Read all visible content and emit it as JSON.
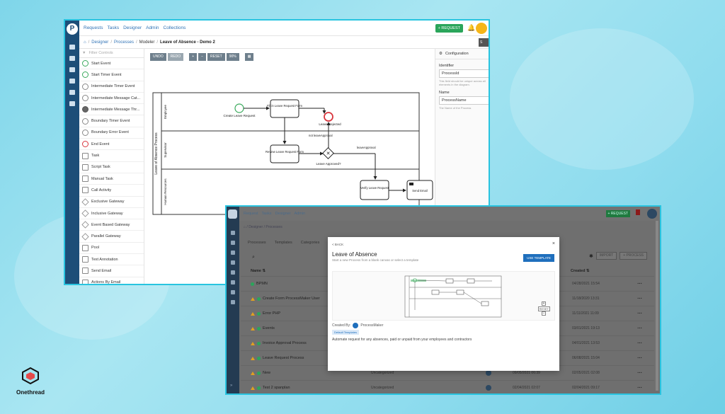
{
  "modeler": {
    "nav": [
      "Requests",
      "Tasks",
      "Designer",
      "Admin",
      "Collections"
    ],
    "request_button": "+ REQUEST",
    "breadcrumb": [
      "Designer",
      "Processes",
      "Modeler"
    ],
    "breadcrumb_current": "Leave of Absence - Demo 2",
    "save_label": "S",
    "filter_placeholder": "Filter Controls",
    "palette": [
      "Start Event",
      "Start Timer Event",
      "Intermediate Timer Event",
      "Intermediate Message Cat...",
      "Intermediate Message Thr...",
      "Boundary Timer Event",
      "Boundary Error Event",
      "End Event",
      "Task",
      "Script Task",
      "Manual Task",
      "Call Activity",
      "Exclusive Gateway",
      "Inclusive Gateway",
      "Event Based Gateway",
      "Parallel Gateway",
      "Pool",
      "Text Annotation",
      "Send Email",
      "Actions By Email"
    ],
    "toolbar": {
      "undo": "UNDO",
      "redo": "REDO",
      "plus": "+",
      "minus": "−",
      "reset": "RESET",
      "zoom": "90%"
    },
    "diagram": {
      "pool_label": "Leave of Absence Process",
      "lanes": [
        "Employee",
        "Supervisor",
        "Human Resources"
      ],
      "create_leave": "Create Leave Request",
      "fill_form": "Fill in Leave Request Form",
      "leave_rejected": "Leave Rejected",
      "not_approval": "not leaveApproval",
      "review_form": "Review Leave Request Form",
      "approved_q": "Leave Approved?",
      "leave_approval": "leaveApproval",
      "verify": "Verify Leave Request",
      "send_email": "Send Email",
      "leave_approved": "Leave Approved"
    },
    "config": {
      "header": "Configuration",
      "identifier_label": "Identifier",
      "identifier_value": "ProcessId",
      "identifier_help": "This field should be unique across all elements in the diagram.",
      "name_label": "Name",
      "name_value": "ProcessName",
      "name_help": "The Name of the Process"
    }
  },
  "processes": {
    "nav": [
      "Request",
      "Tasks",
      "Designer",
      "Admin"
    ],
    "request_button": "+ REQUEST",
    "breadcrumb": "Designer / Processes",
    "tabs": [
      "Processes",
      "Templates",
      "Categories"
    ],
    "import_btn": "IMPORT",
    "new_btn": "+ PROCESS",
    "col_name": "Name",
    "col_created": "Created",
    "rows": [
      {
        "name": "BPMN",
        "warn": false,
        "cat": "",
        "mod": "",
        "created": "04/28/2021 15:54"
      },
      {
        "name": "Create Form ProcessMaker User",
        "warn": true,
        "cat": "",
        "mod": "",
        "created": "11/18/2020 13:31"
      },
      {
        "name": "Error PHP",
        "warn": true,
        "cat": "",
        "mod": "",
        "created": "11/11/2021 11:09"
      },
      {
        "name": "Events",
        "warn": true,
        "cat": "",
        "mod": "",
        "created": "03/01/2021 19:13"
      },
      {
        "name": "Invoice Approval Process",
        "warn": true,
        "cat": "",
        "mod": "",
        "created": "04/01/2021 13:53"
      },
      {
        "name": "Leave Request Process",
        "warn": true,
        "cat": "",
        "mod": "",
        "created": "06/08/2021 15:04"
      },
      {
        "name": "New",
        "warn": true,
        "cat": "Uncategorized",
        "mod": "09/05/2021 06:39",
        "created": "02/05/2021 02:08"
      },
      {
        "name": "Test 2 spanplan",
        "warn": true,
        "cat": "Uncategorized",
        "mod": "02/04/2021 02:07",
        "created": "02/04/2021 09:17"
      }
    ]
  },
  "modal": {
    "back": "< BACK",
    "close": "×",
    "title": "Leave of Absence",
    "subtitle": "Start a new Process from a blank canvas or select a template",
    "use_template": "USE TEMPLATE",
    "created_by_label": "Created By:",
    "created_by": "ProcessMaker",
    "badge": "Default Templates",
    "description": "Automate request for any absences, paid or unpaid from your employees and contractors",
    "zoom_reset": "RESET"
  },
  "brand": {
    "name": "Onethread"
  }
}
